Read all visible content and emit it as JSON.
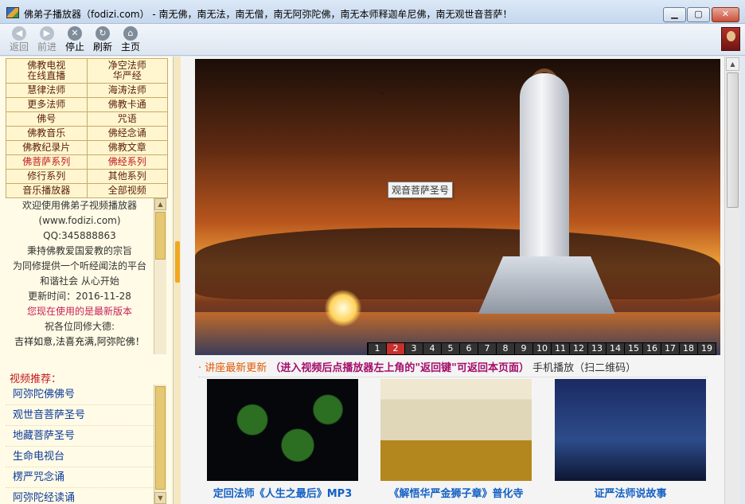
{
  "window": {
    "title": "佛弟子播放器（fodizi.com） - 南无佛，南无法，南无僧，南无阿弥陀佛，南无本师释迦牟尼佛，南无观世音菩萨！",
    "min_label": "▁",
    "max_label": "▢",
    "close_label": "✕"
  },
  "toolbar": {
    "back": "返回",
    "forward": "前进",
    "stop": "停止",
    "refresh": "刷新",
    "home": "主页"
  },
  "nav": {
    "rows": [
      [
        "佛教电视\n在线直播",
        "净空法师\n华严经"
      ],
      [
        "慧律法师",
        "海涛法师"
      ],
      [
        "更多法师",
        "佛教卡通"
      ],
      [
        "佛号",
        "咒语"
      ],
      [
        "佛教音乐",
        "佛经念诵"
      ],
      [
        "佛教纪录片",
        "佛教文章"
      ],
      [
        "佛菩萨系列",
        "佛经系列"
      ],
      [
        "修行系列",
        "其他系列"
      ],
      [
        "音乐播放器",
        "全部视频"
      ]
    ]
  },
  "welcome": {
    "line1": "欢迎使用佛弟子视频播放器",
    "line2": "(www.fodizi.com)",
    "line3": "QQ:345888863",
    "line4": "秉持佛教爱国爱教的宗旨",
    "line5": "为同修提供一个听经闻法的平台",
    "line6": "和谐社会 从心开始",
    "line7": "更新时间：2016-11-28",
    "line8": "您现在使用的是最新版本",
    "line9": "祝各位同修大德:",
    "line10": "吉祥如意,法喜充满,阿弥陀佛！"
  },
  "recommend": {
    "title": "视频推荐：",
    "items": [
      "阿弥陀佛佛号",
      "观世音菩萨圣号",
      "地藏菩萨圣号",
      "生命电视台",
      "楞严咒念诵",
      "阿弥陀经读诵"
    ]
  },
  "banner": {
    "tooltip": "观音菩萨圣号",
    "pages": [
      "1",
      "2",
      "3",
      "4",
      "5",
      "6",
      "7",
      "8",
      "9",
      "10",
      "11",
      "12",
      "13",
      "14",
      "15",
      "16",
      "17",
      "18",
      "19"
    ],
    "active_page": "2"
  },
  "updates": {
    "heading": "· 讲座最新更新",
    "notice": "（进入视频后点播放器左上角的\"返回键\"可返回本页面）",
    "mobile": "手机播放（扫二维码）"
  },
  "videos": [
    {
      "caption": "定回法师《人生之最后》MP3"
    },
    {
      "caption": "《解悟华严金狮子章》普化寺"
    },
    {
      "caption": "证严法师说故事"
    }
  ],
  "scroll": {
    "up": "▲",
    "down": "▼",
    "left": "◀"
  },
  "colors": {
    "accent": "#f0a820",
    "nav_text": "#5a1f0a",
    "link": "#0b3a9b"
  }
}
